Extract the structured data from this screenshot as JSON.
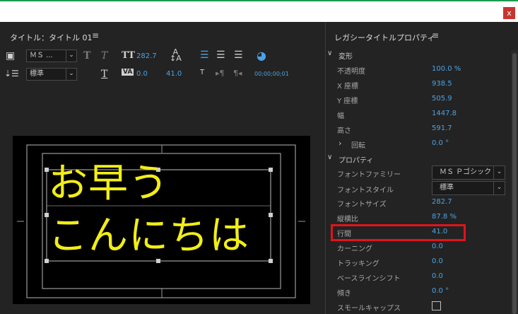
{
  "window": {
    "close_label": "x"
  },
  "left_panel": {
    "title": "タイトル：タイトル 01",
    "menu_icon": "≡",
    "toolbar": {
      "font_family_value": "ＭＳ ...",
      "font_style_value": "標準",
      "font_size_value": "282.7",
      "kerning_value": "0.0",
      "leading_value": "41.0",
      "timecode_value": "00;00;00;01",
      "tt_icon_label": "TT",
      "va_icon_label": "VA",
      "tab_label": "T"
    },
    "canvas": {
      "line1": "お早う",
      "line2": "こんにちは",
      "text_color": "#f2ee16"
    }
  },
  "right_panel": {
    "title": "レガシータイトルプロパティ",
    "menu_icon": "≡",
    "sections": {
      "transform": "変形",
      "properties": "プロパティ"
    },
    "transform_rows": [
      {
        "label": "不透明度",
        "value": "100.0 %"
      },
      {
        "label": "X 座標",
        "value": "938.5"
      },
      {
        "label": "Y 座標",
        "value": "505.9"
      },
      {
        "label": "幅",
        "value": "1447.8"
      },
      {
        "label": "高さ",
        "value": "591.7"
      },
      {
        "label": "回転",
        "value": "0.0 °"
      }
    ],
    "property_rows": [
      {
        "label": "フォントファミリー",
        "value": "ＭＳ Ｐゴシック"
      },
      {
        "label": "フォントスタイル",
        "value": "標準"
      },
      {
        "label": "フォントサイズ",
        "value": "282.7"
      },
      {
        "label": "縦横比",
        "value": "87.8 %"
      },
      {
        "label": "行間",
        "value": "41.0"
      },
      {
        "label": "カーニング",
        "value": "0.0"
      },
      {
        "label": "トラッキング",
        "value": "0.0"
      },
      {
        "label": "ベースラインシフト",
        "value": "0.0"
      },
      {
        "label": "傾き",
        "value": "0.0 °"
      },
      {
        "label": "スモールキャップス",
        "value": ""
      }
    ],
    "highlight_color": "#e0141a",
    "accent_color": "#4aa3e6"
  }
}
